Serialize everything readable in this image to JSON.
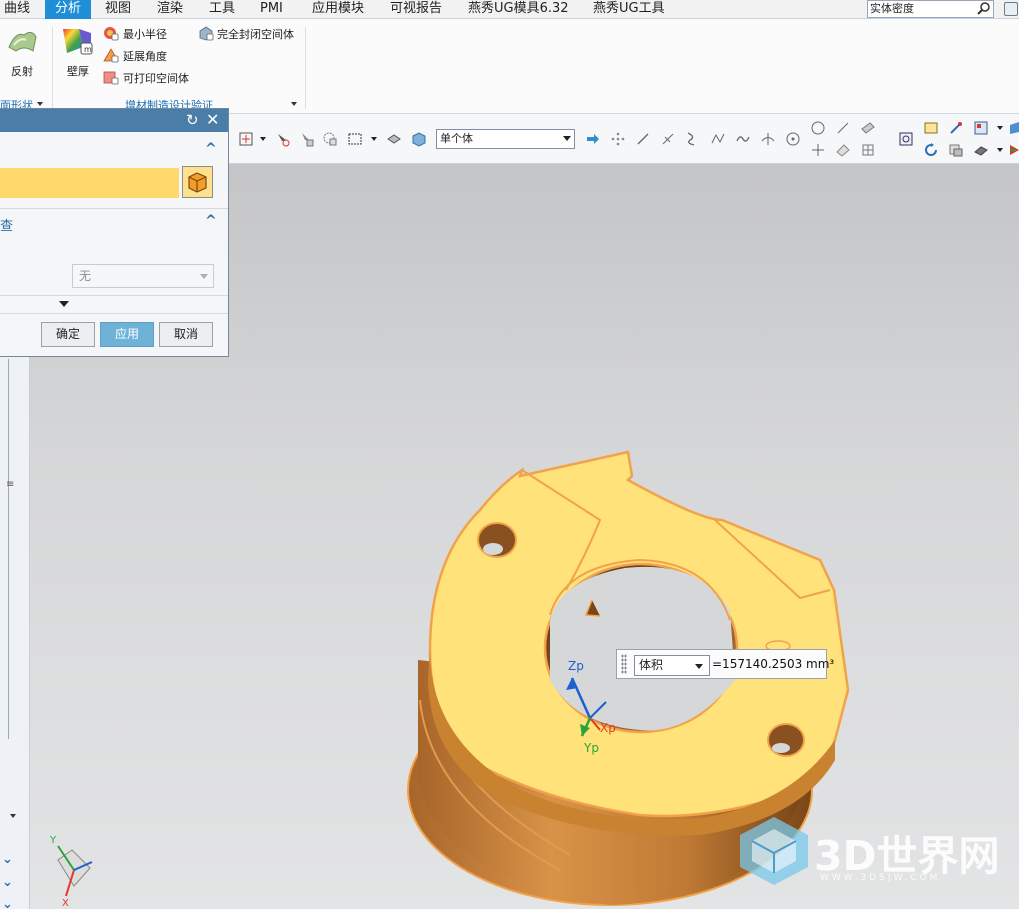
{
  "menu": {
    "items": [
      "曲线",
      "分析",
      "视图",
      "渲染",
      "工具",
      "PMI",
      "应用模块",
      "可视报告",
      "燕秀UG模具6.32",
      "燕秀UG工具"
    ],
    "active_index": 1,
    "search_value": "实体密度"
  },
  "ribbon": {
    "reflect_label": "反射",
    "thickness_label": "壁厚",
    "min_radius_label": "最小半径",
    "extend_angle_label": "延展角度",
    "printable_volume_label": "可打印空间体",
    "closed_volume_label": "完全封闭空间体",
    "group_face_shape": "面形状",
    "group_am": "增材制造设计验证"
  },
  "toolbar": {
    "body_filter": "单个体"
  },
  "dialog": {
    "section2_label": "查",
    "dropdown_value": "无",
    "ok_label": "确定",
    "apply_label": "应用",
    "cancel_label": "取消"
  },
  "viewport": {
    "axis_labels": {
      "zp": "Zp",
      "xp": "Xp",
      "yp": "Yp"
    },
    "triad_labels": {
      "y": "Y",
      "x": "X"
    },
    "measure": {
      "type": "体积",
      "value": "=157140.2503 mm³"
    }
  },
  "watermark": {
    "brand": "3D世界网",
    "url": "WWW.3DSJW.COM"
  },
  "colors": {
    "menu_active": "#1e8fd6",
    "dialog_title": "#4a7ea8",
    "selection_field": "#ffd96b",
    "apply_button": "#6fb2d8",
    "model_face": "#ffe27a",
    "model_edge": "#f2a24a",
    "model_side": "#c9822f"
  }
}
